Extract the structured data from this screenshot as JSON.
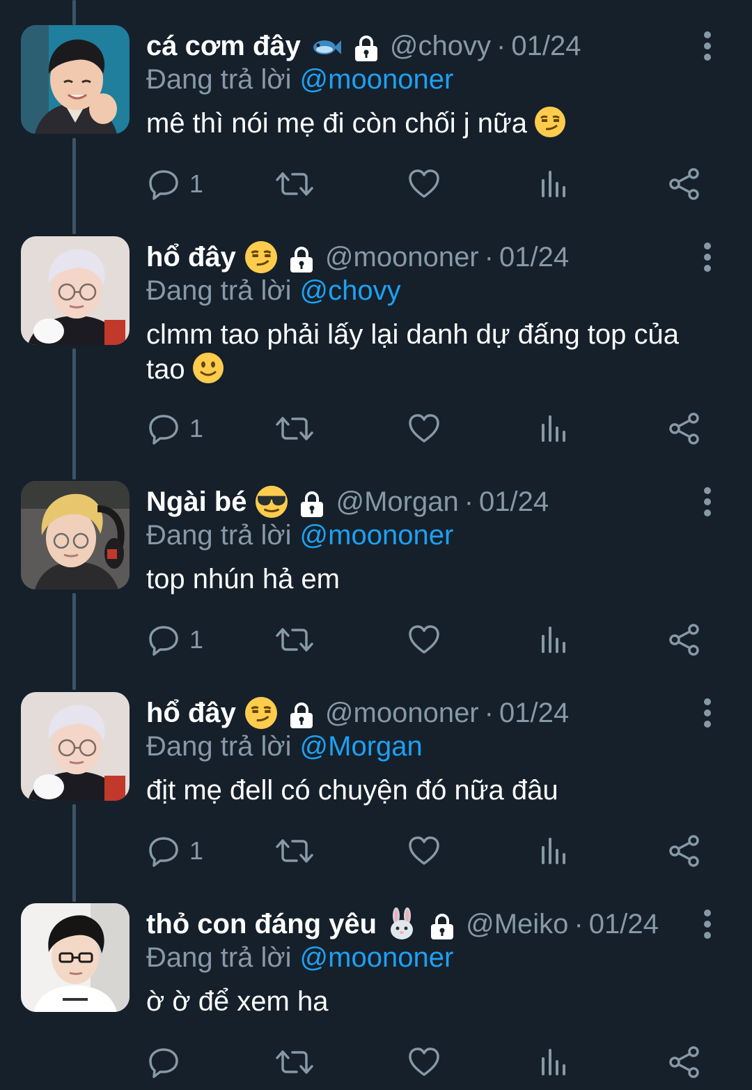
{
  "colors": {
    "background": "#15202b",
    "text": "#ffffff",
    "muted": "#8899a6",
    "link": "#1da1f2",
    "thread_line": "#3d5466"
  },
  "tweets": [
    {
      "display_name": "cá cơm đây",
      "name_emoji": "fish-emoji",
      "lock": "lock-icon",
      "handle": "@chovy",
      "separator": "·",
      "date": "01/24",
      "reply_prefix": "Đang trả lời",
      "reply_to": "@moononer",
      "text": "mê thì nói mẹ đi còn chối j nữa",
      "text_emoji": "smirking-face-emoji",
      "reply_count": "1"
    },
    {
      "display_name": "hổ đây",
      "name_emoji": "smirking-face-emoji",
      "lock": "lock-icon",
      "handle": "@moononer",
      "separator": "·",
      "date": "01/24",
      "reply_prefix": "Đang trả lời",
      "reply_to": "@chovy",
      "text": "clmm tao phải lấy lại danh dự đấng top của tao",
      "text_emoji": "slightly-smiling-face-emoji",
      "reply_count": "1"
    },
    {
      "display_name": "Ngài bé",
      "name_emoji": "sunglasses-face-emoji",
      "lock": "lock-icon",
      "handle": "@Morgan",
      "separator": "·",
      "date": "01/24",
      "reply_prefix": "Đang trả lời",
      "reply_to": "@moononer",
      "text": "top nhún hả em",
      "text_emoji": "",
      "reply_count": "1"
    },
    {
      "display_name": "hổ đây",
      "name_emoji": "smirking-face-emoji",
      "lock": "lock-icon",
      "handle": "@moononer",
      "separator": "·",
      "date": "01/24",
      "reply_prefix": "Đang trả lời",
      "reply_to": "@Morgan",
      "text": "địt mẹ đell có chuyện đó nữa đâu",
      "text_emoji": "",
      "reply_count": "1"
    },
    {
      "display_name": "thỏ con đáng yêu",
      "name_emoji": "rabbit-face-emoji",
      "lock": "lock-icon",
      "handle": "@Meiko",
      "separator": "·",
      "date": "01/24",
      "reply_prefix": "Đang trả lời",
      "reply_to": "@moononer",
      "text": "ờ ờ để xem ha",
      "text_emoji": "",
      "reply_count": ""
    }
  ]
}
